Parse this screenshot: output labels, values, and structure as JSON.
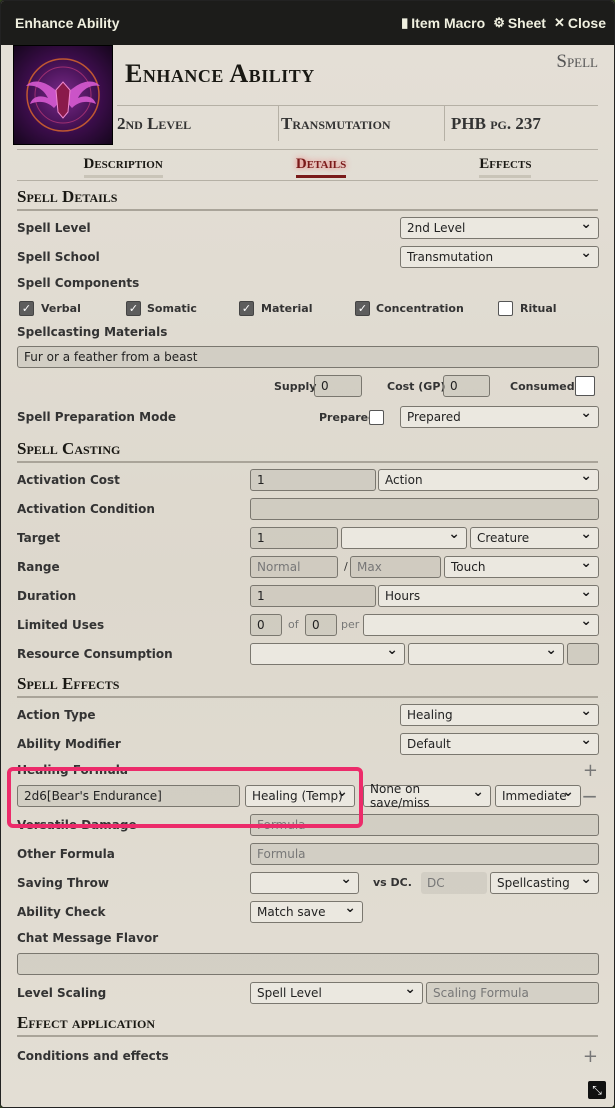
{
  "window": {
    "title": "Enhance Ability",
    "buttons": {
      "item_macro": "Item Macro",
      "sheet": "Sheet",
      "close": "Close"
    }
  },
  "header": {
    "name": "Enhance Ability",
    "type": "Spell",
    "level": "2nd Level",
    "school": "Transmutation",
    "source": "PHB pg. 237"
  },
  "tabs": [
    "Description",
    "Details",
    "Effects"
  ],
  "spell_details": {
    "heading": "Spell Details",
    "level_label": "Spell Level",
    "level_value": "2nd Level",
    "school_label": "Spell School",
    "school_value": "Transmutation",
    "components_label": "Spell Components",
    "components": [
      {
        "label": "Verbal",
        "checked": true
      },
      {
        "label": "Somatic",
        "checked": true
      },
      {
        "label": "Material",
        "checked": true
      },
      {
        "label": "Concentration",
        "checked": true
      },
      {
        "label": "Ritual",
        "checked": false
      }
    ],
    "materials_label": "Spellcasting Materials",
    "materials_value": "Fur or a feather from a beast",
    "supply_label": "Supply",
    "supply_value": "0",
    "cost_label": "Cost (GP)",
    "cost_value": "0",
    "consumed_label": "Consumed",
    "prep_label": "Spell Preparation Mode",
    "prepared_label": "Prepared",
    "prep_value": "Prepared"
  },
  "spell_casting": {
    "heading": "Spell Casting",
    "activation_cost_label": "Activation Cost",
    "activation_cost_value": "1",
    "activation_type": "Action",
    "activation_condition_label": "Activation Condition",
    "target_label": "Target",
    "target_value": "1",
    "target_type": "Creature",
    "range_label": "Range",
    "range_normal_ph": "Normal",
    "range_sep": "/",
    "range_max_ph": "Max",
    "range_units": "Touch",
    "duration_label": "Duration",
    "duration_value": "1",
    "duration_units": "Hours",
    "limited_uses_label": "Limited Uses",
    "uses_value": "0",
    "uses_of": "of",
    "uses_max": "0",
    "uses_per": "per",
    "resource_label": "Resource Consumption"
  },
  "spell_effects": {
    "heading": "Spell Effects",
    "action_type_label": "Action Type",
    "action_type_value": "Healing",
    "ability_mod_label": "Ability Modifier",
    "ability_mod_value": "Default",
    "healing_label": "Healing Formula",
    "healing_formula": "2d6[Bear's Endurance]",
    "healing_type": "Healing (Temp)",
    "save_behavior": "None on save/miss",
    "timing": "Immediate",
    "versatile_label": "Versatile Damage",
    "formula_ph": "Formula",
    "other_label": "Other Formula",
    "saving_throw_label": "Saving Throw",
    "vs_dc": "vs DC.",
    "dc_ph": "DC",
    "save_scaling": "Spellcasting",
    "ability_check_label": "Ability Check",
    "ability_check_value": "Match save",
    "chat_flavor_label": "Chat Message Flavor",
    "level_scaling_label": "Level Scaling",
    "level_scaling_value": "Spell Level",
    "scaling_formula_ph": "Scaling Formula"
  },
  "effect_application": {
    "heading": "Effect application",
    "conditions_label": "Conditions and effects"
  }
}
